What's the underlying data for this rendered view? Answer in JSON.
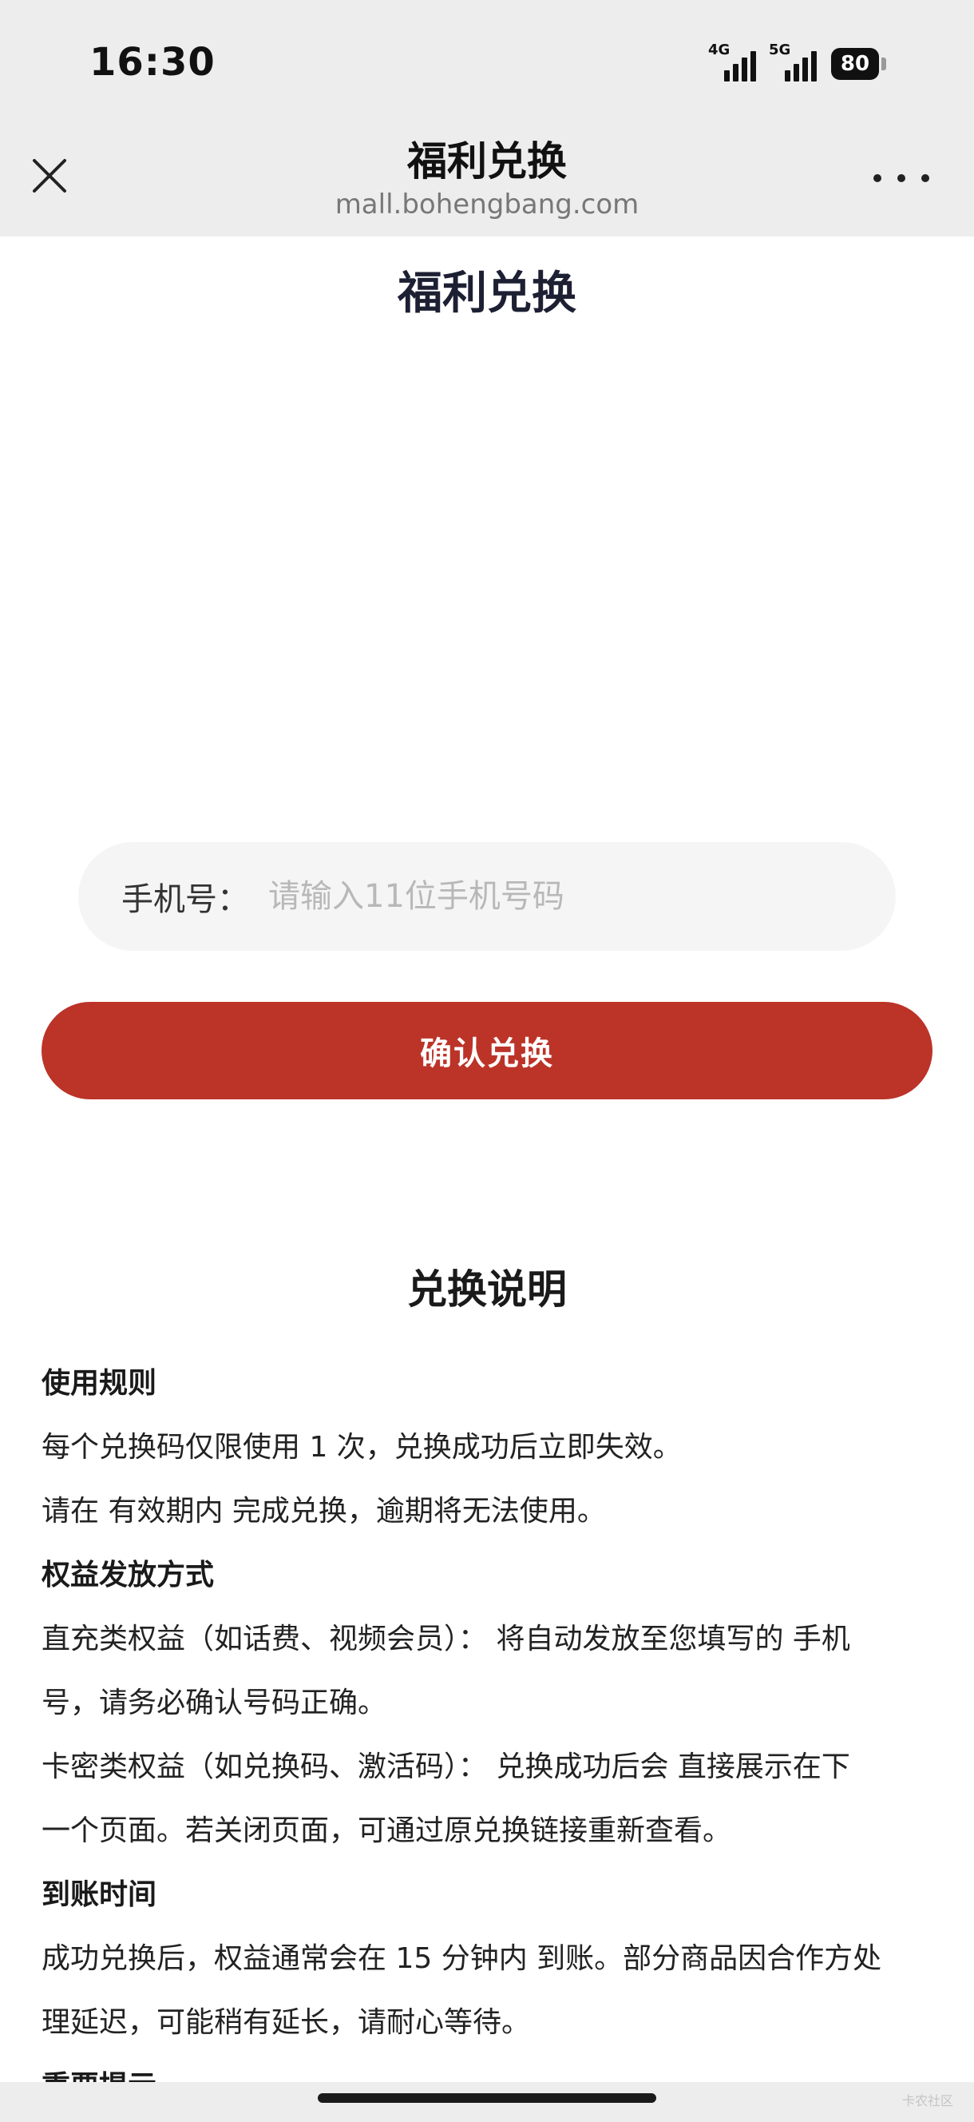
{
  "status_bar": {
    "time": "16:30",
    "network_1": "4G",
    "network_2": "5G",
    "battery": "80"
  },
  "browser_header": {
    "title": "福利兑换",
    "url": "mall.bohengbang.com",
    "close_icon": "close-icon",
    "more_icon": "more-icon"
  },
  "page": {
    "title": "福利兑换"
  },
  "phone_field": {
    "label": "手机号：",
    "placeholder": "请输入11位手机号码",
    "value": ""
  },
  "confirm_button": {
    "label": "确认兑换"
  },
  "instructions": {
    "title": "兑换说明",
    "sections": [
      {
        "heading": "使用规则",
        "lines": [
          "每个兑换码仅限使用 1 次，兑换成功后立即失效。",
          "请在 有效期内 完成兑换，逾期将无法使用。"
        ]
      },
      {
        "heading": "权益发放方式",
        "lines": [
          "直充类权益（如话费、视频会员）： 将自动发放至您填写的 手机",
          "号，请务必确认号码正确。",
          "卡密类权益（如兑换码、激活码）： 兑换成功后会 直接展示在下",
          "一个页面。若关闭页面，可通过原兑换链接重新查看。"
        ]
      },
      {
        "heading": "到账时间",
        "lines": [
          "成功兑换后，权益通常会在 15 分钟内 到账。部分商品因合作方处",
          "理延迟，可能稍有延长，请耐心等待。"
        ]
      },
      {
        "heading": "重要提示",
        "lines": []
      }
    ]
  },
  "watermark": "卡农社区",
  "colors": {
    "chrome_bg": "#ededed",
    "primary_button": "#bc3328",
    "input_bg": "#f5f5f5",
    "title_color": "#1d2033"
  }
}
